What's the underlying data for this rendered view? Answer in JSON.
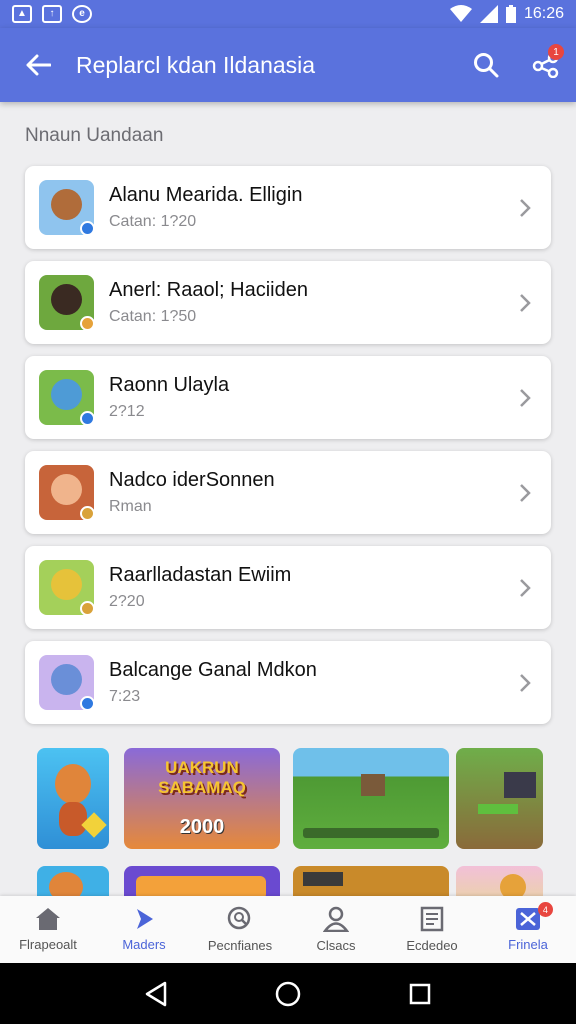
{
  "status_bar": {
    "time": "16:26"
  },
  "app_bar": {
    "title": "Replarcl kdan Ildanasia",
    "notification_count": "1"
  },
  "section": {
    "label": "Nnaun Uandaan"
  },
  "items": [
    {
      "title": "Alanu Mearida. Elligin",
      "subtitle": "Catan: 1?20",
      "color": "#8fc4ee",
      "face": "#b06c3a"
    },
    {
      "title": "Anerl: Raaol; Haciiden",
      "subtitle": "Catan: 1?50",
      "color": "#6ea83e",
      "face": "#3a2a22"
    },
    {
      "title": "Raonn Ulayla",
      "subtitle": "2?12",
      "color": "#7bbb4a",
      "face": "#4e9bd6"
    },
    {
      "title": "Nadco iderSonnen",
      "subtitle": "Rman",
      "color": "#c7643a",
      "face": "#f0b48c"
    },
    {
      "title": "Raarlladastan Ewiim",
      "subtitle": "2?20",
      "color": "#a4d05a",
      "face": "#e6c23a"
    },
    {
      "title": "Balcange Ganal Mdkon",
      "subtitle": "7:23",
      "color": "#c9b4ee",
      "face": "#6a8fd8"
    }
  ],
  "thumbnails": [
    {
      "text": "",
      "bg": "#3fb0e6"
    },
    {
      "text": "UAKRUN SABAMAQ",
      "number": "2000",
      "bg": "#e6893a"
    },
    {
      "text": "",
      "bg": "#5fae3e"
    },
    {
      "text": "",
      "bg": "#8a6a3a"
    }
  ],
  "bottom_nav": [
    {
      "label": "Flrapeoalt",
      "icon": "home-icon"
    },
    {
      "label": "Maders",
      "icon": "play-icon"
    },
    {
      "label": "Pecnfianes",
      "icon": "chat-search-icon"
    },
    {
      "label": "Clsacs",
      "icon": "person-icon"
    },
    {
      "label": "Ecdedeo",
      "icon": "document-icon"
    },
    {
      "label": "Frinela",
      "icon": "flag-icon",
      "badge": "4"
    }
  ],
  "colors": {
    "primary": "#5a72dd",
    "accent": "#4b64d8",
    "badge": "#e8463f"
  }
}
